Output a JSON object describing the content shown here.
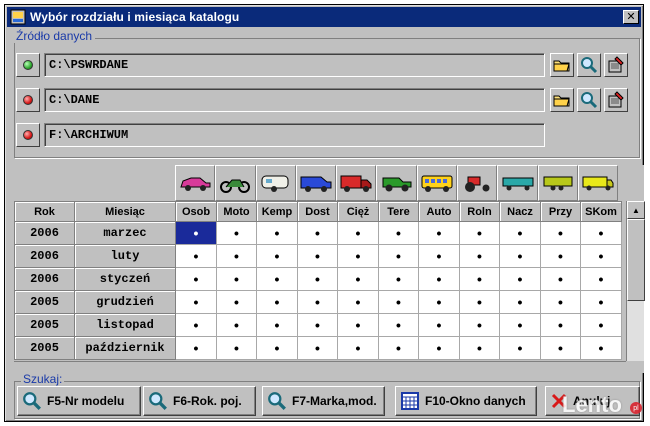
{
  "window": {
    "title": "Wybór rozdziału i miesiąca katalogu",
    "close_label": "✕"
  },
  "source_group": {
    "legend": "Źródło danych",
    "rows": [
      {
        "path": "C:\\PSWRDANE",
        "status": "green",
        "status_color": "#3fbf3f",
        "has_tools": true
      },
      {
        "path": "C:\\DANE",
        "status": "red",
        "status_color": "#e02020",
        "has_tools": true
      },
      {
        "path": "F:\\ARCHIWUM",
        "status": "red",
        "status_color": "#e02020",
        "has_tools": false
      }
    ]
  },
  "vehicle_icons": [
    "car-icon",
    "motorcycle-icon",
    "camper-icon",
    "van-icon",
    "truck-icon",
    "offroad-icon",
    "bus-icon",
    "tractor-icon",
    "semitrailer-icon",
    "trailer-icon",
    "special-vehicle-icon"
  ],
  "grid": {
    "columns": [
      "Rok",
      "Miesiąc",
      "Osob",
      "Moto",
      "Kemp",
      "Dost",
      "Cięż",
      "Tere",
      "Auto",
      "Roln",
      "Nacz",
      "Przy",
      "SKom"
    ],
    "rows": [
      {
        "rok": "2006",
        "miesiac": "marzec",
        "cells": [
          "•",
          "•",
          "•",
          "•",
          "•",
          "•",
          "•",
          "•",
          "•",
          "•",
          "•"
        ]
      },
      {
        "rok": "2006",
        "miesiac": "luty",
        "cells": [
          "•",
          "•",
          "•",
          "•",
          "•",
          "•",
          "•",
          "•",
          "•",
          "•",
          "•"
        ]
      },
      {
        "rok": "2006",
        "miesiac": "styczeń",
        "cells": [
          "•",
          "•",
          "•",
          "•",
          "•",
          "•",
          "•",
          "•",
          "•",
          "•",
          "•"
        ]
      },
      {
        "rok": "2005",
        "miesiac": "grudzień",
        "cells": [
          "•",
          "•",
          "•",
          "•",
          "•",
          "•",
          "•",
          "•",
          "•",
          "•",
          "•"
        ]
      },
      {
        "rok": "2005",
        "miesiac": "listopad",
        "cells": [
          "•",
          "•",
          "•",
          "•",
          "•",
          "•",
          "•",
          "•",
          "•",
          "•",
          "•"
        ]
      },
      {
        "rok": "2005",
        "miesiac": "październik",
        "cells": [
          "•",
          "•",
          "•",
          "•",
          "•",
          "•",
          "•",
          "•",
          "•",
          "•",
          "•"
        ]
      }
    ],
    "selected_row": 0,
    "selected_col": 0
  },
  "search": {
    "legend": "Szukaj:",
    "buttons": [
      {
        "label": "F5-Nr modelu",
        "icon": "magnifier-icon"
      },
      {
        "label": "F6-Rok. poj.",
        "icon": "magnifier-icon"
      },
      {
        "label": "F7-Marka,mod.",
        "icon": "magnifier-icon"
      },
      {
        "label": "F10-Okno danych",
        "icon": "data-window-icon"
      },
      {
        "label": "Anuluj",
        "icon": "cancel-icon"
      }
    ]
  },
  "watermark": {
    "text": "Lento",
    "suffix": "pl"
  },
  "colors": {
    "title_bar": "#0a2a7a",
    "accent_blue": "#1a3aa8",
    "selection": "#1a2a9a"
  }
}
